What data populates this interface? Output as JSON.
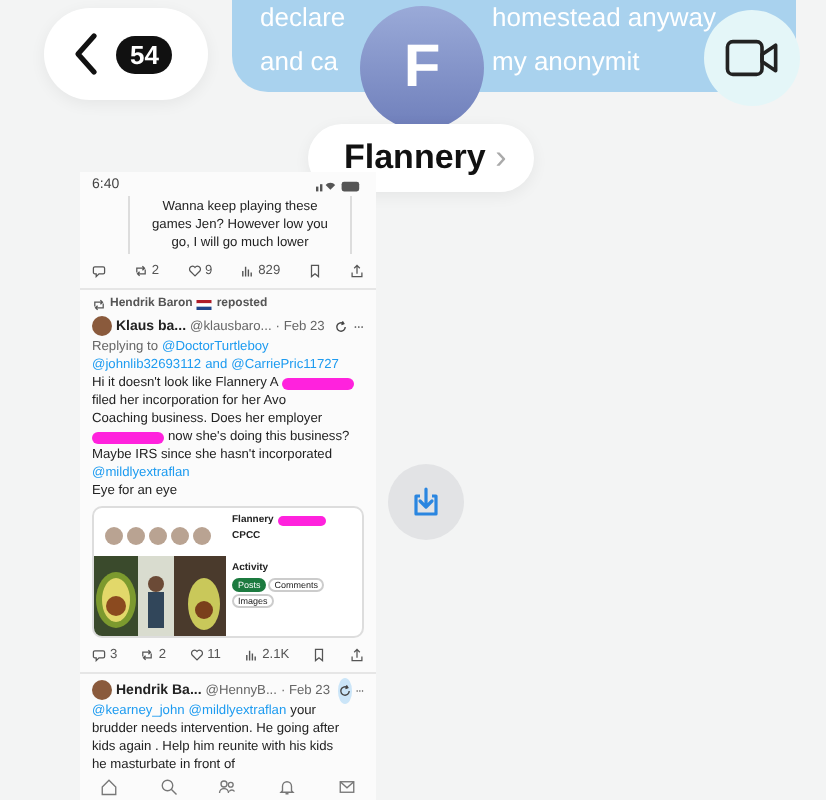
{
  "header": {
    "back_count": "54",
    "avatar_initial": "F",
    "contact_name": "Flannery",
    "chevron": "›"
  },
  "background_bubble": {
    "lines": [
      {
        "left": "declare",
        "right": "homestead anyway"
      },
      {
        "left": "and ca",
        "right": "my anonymit"
      }
    ]
  },
  "screenshot": {
    "status_time": "6:40",
    "quoted_lines": [
      "Wanna keep playing these",
      "games Jen? However low you",
      "go, I will go much lower"
    ],
    "top_actions": [
      {
        "kind": "reply"
      },
      {
        "kind": "repost",
        "count": "2"
      },
      {
        "kind": "like",
        "count": "9"
      },
      {
        "kind": "views",
        "count": "829"
      },
      {
        "kind": "bookmark"
      },
      {
        "kind": "share"
      }
    ],
    "repost_banner": {
      "name": "Hendrik Baron",
      "suffix": "reposted"
    },
    "tweets": [
      {
        "author": "Klaus ba...",
        "handle": "@klausbaro...",
        "date": "· Feb 23",
        "replying_lines": [
          [
            {
              "kind": "text",
              "text": "Replying to"
            },
            {
              "kind": "mention",
              "text": "@DoctorTurtleboy"
            }
          ],
          [
            {
              "kind": "mention",
              "text": "@johnlib32693112"
            },
            {
              "kind": "mention",
              "text": "and"
            },
            {
              "kind": "mention",
              "text": "@CarriePric11727"
            }
          ]
        ],
        "body_lines": [
          [
            {
              "kind": "text",
              "text": "Hi it doesn't look like Flannery A"
            },
            {
              "kind": "redaction"
            }
          ],
          [
            {
              "kind": "text",
              "text": "filed her incorporation for her Avo"
            }
          ],
          [
            {
              "kind": "text",
              "text": "Coaching business. Does her employer"
            }
          ],
          [
            {
              "kind": "redaction"
            },
            {
              "kind": "text",
              "text": "now she's doing this business?"
            }
          ],
          [
            {
              "kind": "text",
              "text": "Maybe IRS since she hasn't incorporated"
            }
          ],
          [
            {
              "kind": "mention",
              "text": "@mildlyextraflan"
            }
          ],
          [
            {
              "kind": "text",
              "text": "Eye for an eye"
            }
          ]
        ],
        "card": {
          "name": "Flannery",
          "title": "CPCC",
          "section": "Activity",
          "chips": [
            "Posts",
            "Comments",
            "Images"
          ]
        },
        "actions": [
          {
            "kind": "reply",
            "count": "3"
          },
          {
            "kind": "repost",
            "count": "2"
          },
          {
            "kind": "like",
            "count": "11"
          },
          {
            "kind": "views",
            "count": "2.1K"
          },
          {
            "kind": "bookmark"
          },
          {
            "kind": "share"
          }
        ]
      },
      {
        "author": "Hendrik Ba...",
        "handle": "@HennyB...",
        "date": "· Feb 23",
        "body_lines": [
          [
            {
              "kind": "mention",
              "text": "@kearney_john"
            },
            {
              "kind": "mention",
              "text": "@mildlyextraflan"
            },
            {
              "kind": "text",
              "text": "your"
            }
          ],
          [
            {
              "kind": "text",
              "text": "brudder needs intervention. He going after"
            }
          ],
          [
            {
              "kind": "text",
              "text": "kids again . Help him reunite with his kids"
            }
          ],
          [
            {
              "kind": "text",
              "text": "he masturbate in front of"
            }
          ]
        ]
      }
    ],
    "tab_bar": [
      {
        "kind": "home"
      },
      {
        "kind": "search"
      },
      {
        "kind": "community"
      },
      {
        "kind": "bell"
      },
      {
        "kind": "mail"
      }
    ]
  }
}
